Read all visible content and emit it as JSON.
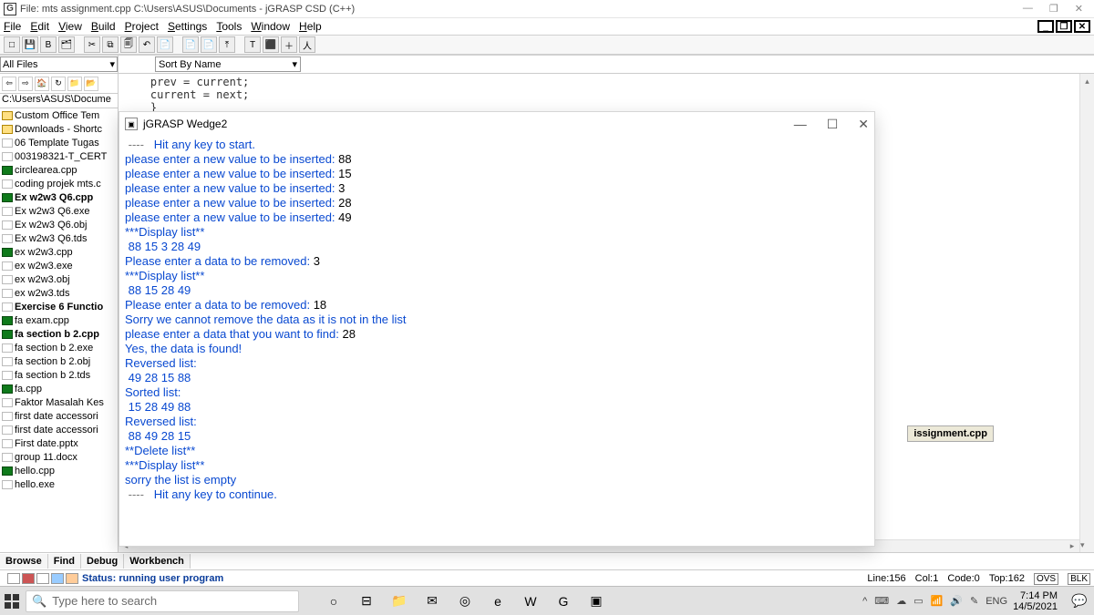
{
  "window": {
    "app_icon_letter": "G",
    "title": "File: mts assignment.cpp  C:\\Users\\ASUS\\Documents - jGRASP CSD (C++)",
    "min": "—",
    "max": "❐",
    "close": "✕"
  },
  "menus": {
    "file": "File",
    "edit": "Edit",
    "view": "View",
    "build": "Build",
    "project": "Project",
    "settings": "Settings",
    "tools": "Tools",
    "window": "Window",
    "help": "Help"
  },
  "mdi": {
    "restore": "❐",
    "min": "_",
    "close": "✕"
  },
  "toolbar_icons": [
    "□",
    "💾",
    "B",
    "🗂",
    "✂",
    "⧉",
    "🗐",
    "↶",
    "📄",
    "📄",
    "📄",
    "⤒",
    "T",
    "⬛",
    "＋",
    "人"
  ],
  "browse": {
    "combo_all_files": "All Files",
    "combo_sort": "Sort By Name",
    "nav_icons": [
      "⇦",
      "⇨",
      "🏠",
      "↻",
      "📁",
      "📂"
    ],
    "path": "C:\\Users\\ASUS\\Docume"
  },
  "tree": [
    {
      "t": "folder",
      "label": "Custom Office Tem"
    },
    {
      "t": "folder",
      "label": "Downloads - Shortc"
    },
    {
      "t": "file",
      "label": "06 Template Tugas"
    },
    {
      "t": "file",
      "label": "003198321-T_CERT"
    },
    {
      "t": "cfile",
      "label": "circlearea.cpp"
    },
    {
      "t": "file",
      "label": "coding projek mts.c"
    },
    {
      "t": "cfile",
      "bold": true,
      "label": "Ex w2w3 Q6.cpp"
    },
    {
      "t": "file",
      "label": "Ex w2w3 Q6.exe"
    },
    {
      "t": "file",
      "label": "Ex w2w3 Q6.obj"
    },
    {
      "t": "file",
      "label": "Ex w2w3 Q6.tds"
    },
    {
      "t": "cfile",
      "label": "ex w2w3.cpp"
    },
    {
      "t": "file",
      "label": "ex w2w3.exe"
    },
    {
      "t": "file",
      "label": "ex w2w3.obj"
    },
    {
      "t": "file",
      "label": "ex w2w3.tds"
    },
    {
      "t": "file",
      "bold": true,
      "label": "Exercise 6 Functio"
    },
    {
      "t": "cfile",
      "label": "fa exam.cpp"
    },
    {
      "t": "cfile",
      "bold": true,
      "label": "fa section b 2.cpp"
    },
    {
      "t": "file",
      "label": "fa section b 2.exe"
    },
    {
      "t": "file",
      "label": "fa section b 2.obj"
    },
    {
      "t": "file",
      "label": "fa section b 2.tds"
    },
    {
      "t": "cfile",
      "label": "fa.cpp"
    },
    {
      "t": "file",
      "label": "Faktor Masalah Kes"
    },
    {
      "t": "file",
      "label": "first date accessori"
    },
    {
      "t": "file",
      "label": "first date accessori"
    },
    {
      "t": "file",
      "label": "First date.pptx"
    },
    {
      "t": "file",
      "label": "group 11.docx"
    },
    {
      "t": "cfile",
      "label": "hello.cpp"
    },
    {
      "t": "file",
      "label": "hello.exe"
    }
  ],
  "code_lines": [
    "prev = current;",
    "current = next;",
    "}"
  ],
  "tab_filename": "issignment.cpp",
  "bottom_tabs": [
    "Browse",
    "Find",
    "Debug",
    "Workbench"
  ],
  "status": {
    "left": "Status: running user program",
    "line": "Line:156",
    "col": "Col:1",
    "code": "Code:0",
    "top": "Top:162",
    "ovs": "OVS",
    "blk": "BLK"
  },
  "wedge": {
    "title": "jGRASP Wedge2",
    "lines": [
      {
        "cls": "gray",
        "txt": " ----   "
      },
      {
        "cls": "blue",
        "txt": "Hit any key to start."
      },
      {
        "cls": "blue",
        "txt": "please enter a new value to be inserted: ",
        "tail": "88"
      },
      {
        "cls": "blue",
        "txt": "please enter a new value to be inserted: ",
        "tail": "15"
      },
      {
        "cls": "blue",
        "txt": "please enter a new value to be inserted: ",
        "tail": "3"
      },
      {
        "cls": "blue",
        "txt": "please enter a new value to be inserted: ",
        "tail": "28"
      },
      {
        "cls": "blue",
        "txt": "please enter a new value to be inserted: ",
        "tail": "49"
      },
      {
        "cls": "blue",
        "txt": "***Display list**"
      },
      {
        "cls": "blue",
        "txt": " 88 15 3 28 49"
      },
      {
        "cls": "blue",
        "txt": "Please enter a data to be removed: ",
        "tail": "3"
      },
      {
        "cls": "blue",
        "txt": "***Display list**"
      },
      {
        "cls": "blue",
        "txt": " 88 15 28 49"
      },
      {
        "cls": "blue",
        "txt": "Please enter a data to be removed: ",
        "tail": "18"
      },
      {
        "cls": "blue",
        "txt": "Sorry we cannot remove the data as it is not in the list"
      },
      {
        "cls": "blue",
        "txt": "please enter a data that you want to find: ",
        "tail": "28"
      },
      {
        "cls": "blue",
        "txt": "Yes, the data is found!"
      },
      {
        "cls": "blue",
        "txt": "Reversed list:"
      },
      {
        "cls": "blue",
        "txt": " 49 28 15 88"
      },
      {
        "cls": "blue",
        "txt": "Sorted list:"
      },
      {
        "cls": "blue",
        "txt": " 15 28 49 88"
      },
      {
        "cls": "blue",
        "txt": "Reversed list:"
      },
      {
        "cls": "blue",
        "txt": " 88 49 28 15"
      },
      {
        "cls": "blue",
        "txt": "**Delete list**"
      },
      {
        "cls": "blue",
        "txt": "***Display list**"
      },
      {
        "cls": "blue",
        "txt": "sorry the list is empty"
      },
      {
        "cls": "black",
        "txt": ""
      },
      {
        "cls": "gray",
        "txt": " ----   "
      },
      {
        "cls": "blue",
        "txt": "Hit any key to continue."
      }
    ]
  },
  "taskbar": {
    "search_placeholder": "Type here to search",
    "icons": [
      "○",
      "⊟",
      "📁",
      "✉",
      "◎",
      "e",
      "W",
      "G",
      "▣"
    ],
    "tray": [
      "^",
      "⌨",
      "☁",
      "▭",
      "📶",
      "🔊",
      "✎",
      "ENG"
    ],
    "time": "7:14 PM",
    "date": "14/5/2021"
  }
}
